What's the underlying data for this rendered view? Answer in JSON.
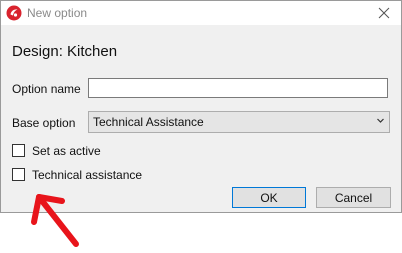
{
  "window": {
    "title": "New option",
    "close_glyph": "✕"
  },
  "heading": "Design: Kitchen",
  "form": {
    "option_name_label": "Option name",
    "option_name_value": "",
    "base_option_label": "Base option",
    "base_option_value": "Technical Assistance",
    "set_as_active_label": "Set as active",
    "set_as_active_checked": false,
    "technical_assistance_label": "Technical assistance",
    "technical_assistance_checked": false
  },
  "buttons": {
    "ok": "OK",
    "cancel": "Cancel"
  },
  "colors": {
    "annotation_arrow": "#e8141b",
    "app_icon": "#d9232e",
    "default_button_border": "#0078d7"
  },
  "icons": [
    "app-logo-icon",
    "close-icon",
    "chevron-down-icon",
    "red-annotation-arrow"
  ]
}
